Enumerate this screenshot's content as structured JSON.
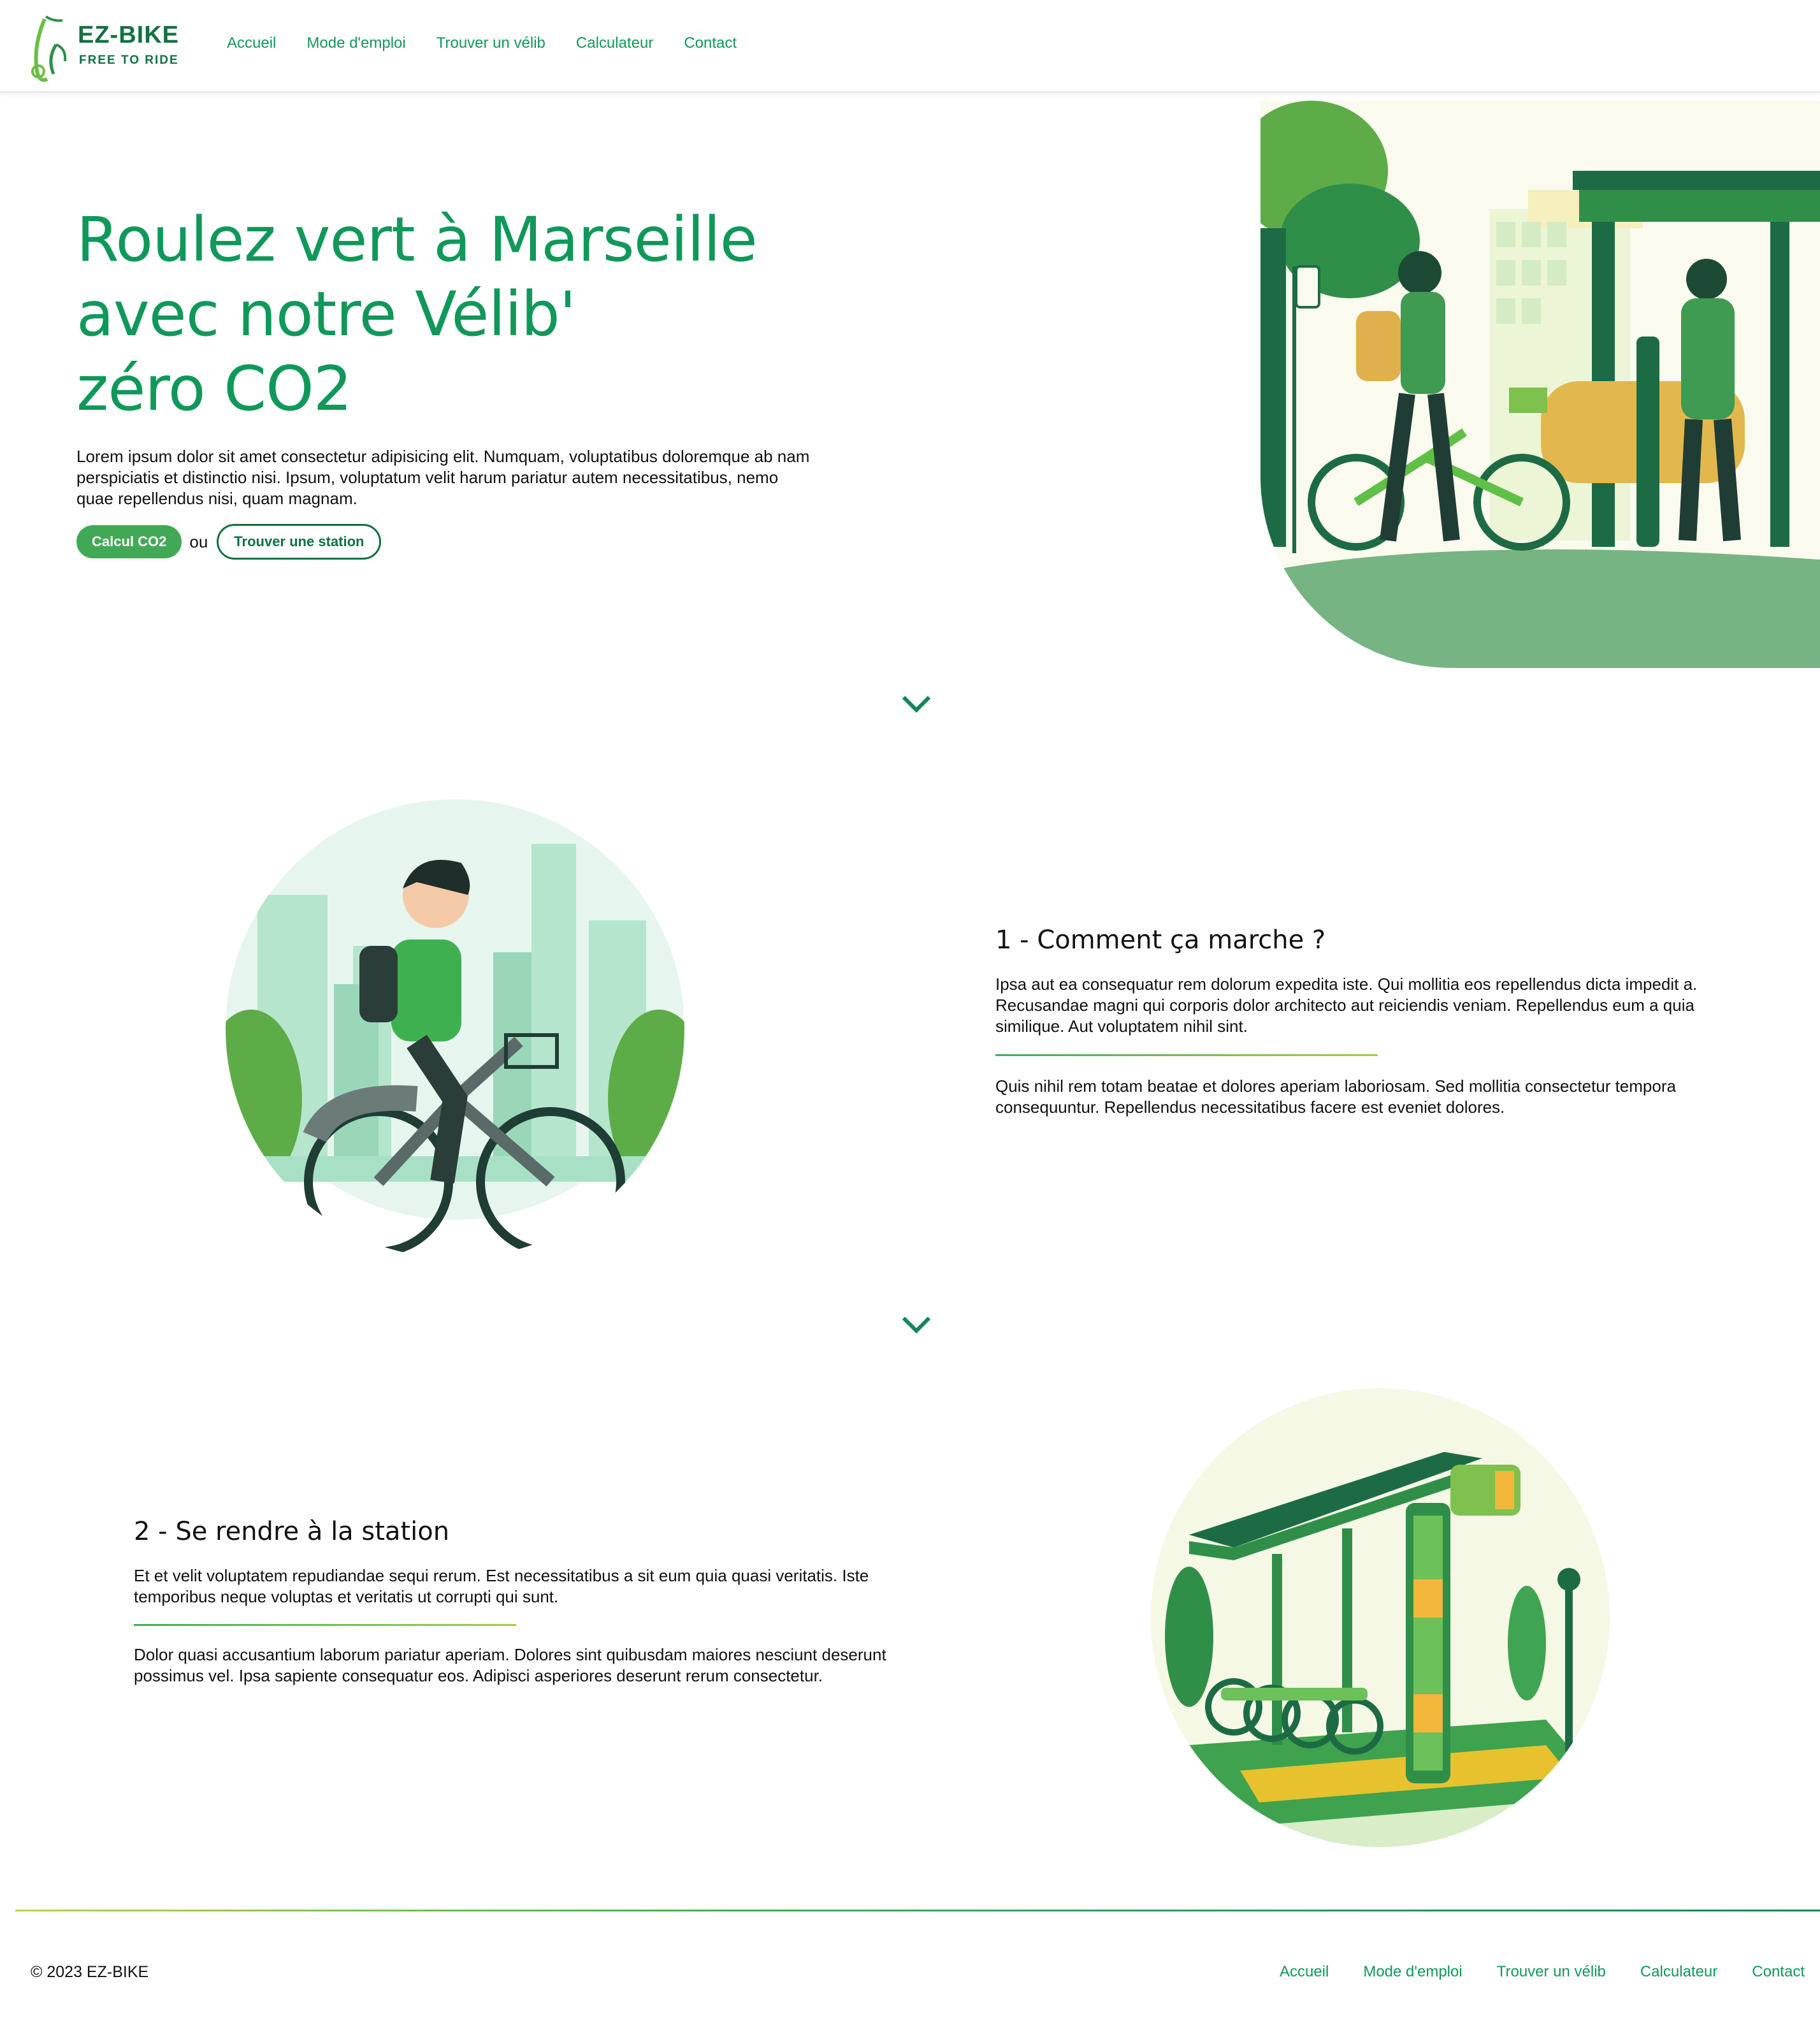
{
  "brand": {
    "name": "EZ-BIKE",
    "tagline": "FREE TO RIDE"
  },
  "nav": {
    "links": [
      "Accueil",
      "Mode d'emploi",
      "Trouver un vélib",
      "Calculateur",
      "Contact"
    ]
  },
  "hero": {
    "title_lines": [
      "Roulez vert à Marseille",
      "avec notre Vélib'",
      "zéro CO2"
    ],
    "text": "Lorem ipsum dolor sit amet consectetur adipisicing elit. Numquam, voluptatibus doloremque ab nam perspiciatis et distinctio nisi. Ipsum, voluptatum velit harum pariatur autem necessitatibus, nemo quae repellendus nisi, quam magnam.",
    "primary_button": "Calcul CO2",
    "or_text": "ou",
    "secondary_button": "Trouver une station"
  },
  "step1": {
    "title": "1 - Comment ça marche ?",
    "paragraph1": "Ipsa aut ea consequatur rem dolorum expedita iste. Qui mollitia eos repellendus dicta impedit a. Recusandae magni qui corporis dolor architecto aut reiciendis veniam. Repellendus eum a quia similique. Aut voluptatem nihil sint.",
    "paragraph2": "Quis nihil rem totam beatae et dolores aperiam laboriosam. Sed mollitia consectetur tempora consequuntur. Repellendus necessitatibus facere est eveniet dolores."
  },
  "step2": {
    "title": "2 - Se rendre à la station",
    "paragraph1": "Et et velit voluptatem repudiandae sequi rerum. Est necessitatibus a sit eum quia quasi veritatis. Iste temporibus neque voluptas et veritatis ut corrupti qui sunt.",
    "paragraph2": "Dolor quasi accusantium laborum pariatur aperiam. Dolores sint quibusdam maiores nesciunt deserunt possimus vel. Ipsa sapiente consequatur eos. Adipisci asperiores deserunt rerum consectetur."
  },
  "footer": {
    "copyright": "© 2023 EZ-BIKE",
    "links": [
      "Accueil",
      "Mode d'emploi",
      "Trouver un vélib",
      "Calculateur",
      "Contact"
    ]
  },
  "colors": {
    "primary": "#10985a",
    "dark_green": "#137043",
    "button_green": "#41a955",
    "accent_lime": "#a8cf3f"
  },
  "icons": {
    "scroll": "chevron-down-icon",
    "logo": "bike-logo-icon"
  }
}
